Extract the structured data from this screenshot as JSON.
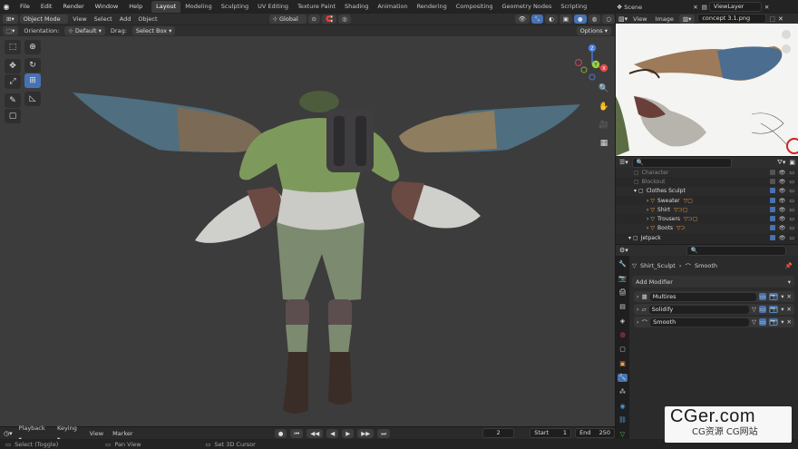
{
  "topbar": {
    "menu": [
      "File",
      "Edit",
      "Render",
      "Window",
      "Help"
    ],
    "workspaces": [
      "Layout",
      "Modeling",
      "Sculpting",
      "UV Editing",
      "Texture Paint",
      "Shading",
      "Animation",
      "Rendering",
      "Compositing",
      "Geometry Nodes",
      "Scripting"
    ],
    "active_workspace": "Layout",
    "scene_label": "Scene",
    "viewlayer_label": "ViewLayer"
  },
  "viewport_header": {
    "mode": "Object Mode",
    "menus": [
      "View",
      "Select",
      "Add",
      "Object"
    ],
    "transform_orientation": "Global"
  },
  "tool_header": {
    "orientation_label": "Orientation:",
    "orientation_value": "Default",
    "drag_label": "Drag:",
    "drag_value": "Select Box",
    "options_label": "Options"
  },
  "gizmo": {
    "x": "X",
    "y": "Y",
    "z": "Z"
  },
  "image_editor": {
    "menus": [
      "View",
      "Image"
    ],
    "image_name": "concept 3.1.png"
  },
  "outliner": {
    "rows": [
      {
        "label": "Character",
        "depth": 1,
        "dim": true
      },
      {
        "label": "Blockout",
        "depth": 1,
        "dim": true
      },
      {
        "label": "Clothes Sculpt",
        "depth": 1,
        "dim": false
      },
      {
        "label": "Sweater",
        "depth": 2,
        "dim": false
      },
      {
        "label": "Shirt",
        "depth": 2,
        "dim": false
      },
      {
        "label": "Trousers",
        "depth": 2,
        "dim": false
      },
      {
        "label": "Boots",
        "depth": 2,
        "dim": false
      },
      {
        "label": "Jetpack",
        "depth": 0,
        "dim": false
      }
    ]
  },
  "properties": {
    "object_name": "Shirt_Sculpt",
    "modifier_context": "Smooth",
    "add_modifier_label": "Add Modifier",
    "modifiers": [
      "Multires",
      "Solidify",
      "Smooth"
    ]
  },
  "timeline": {
    "menus": [
      "Playback",
      "Keying",
      "View",
      "Marker"
    ],
    "current_frame": "2",
    "start_label": "Start",
    "start_value": "1",
    "end_label": "End",
    "end_value": "250"
  },
  "status": {
    "hints": [
      "Select (Toggle)",
      "Pan View",
      "Set 3D Cursor"
    ]
  },
  "watermark": {
    "title": "CGer.com",
    "subtitle": "CG资源 CG网站"
  }
}
